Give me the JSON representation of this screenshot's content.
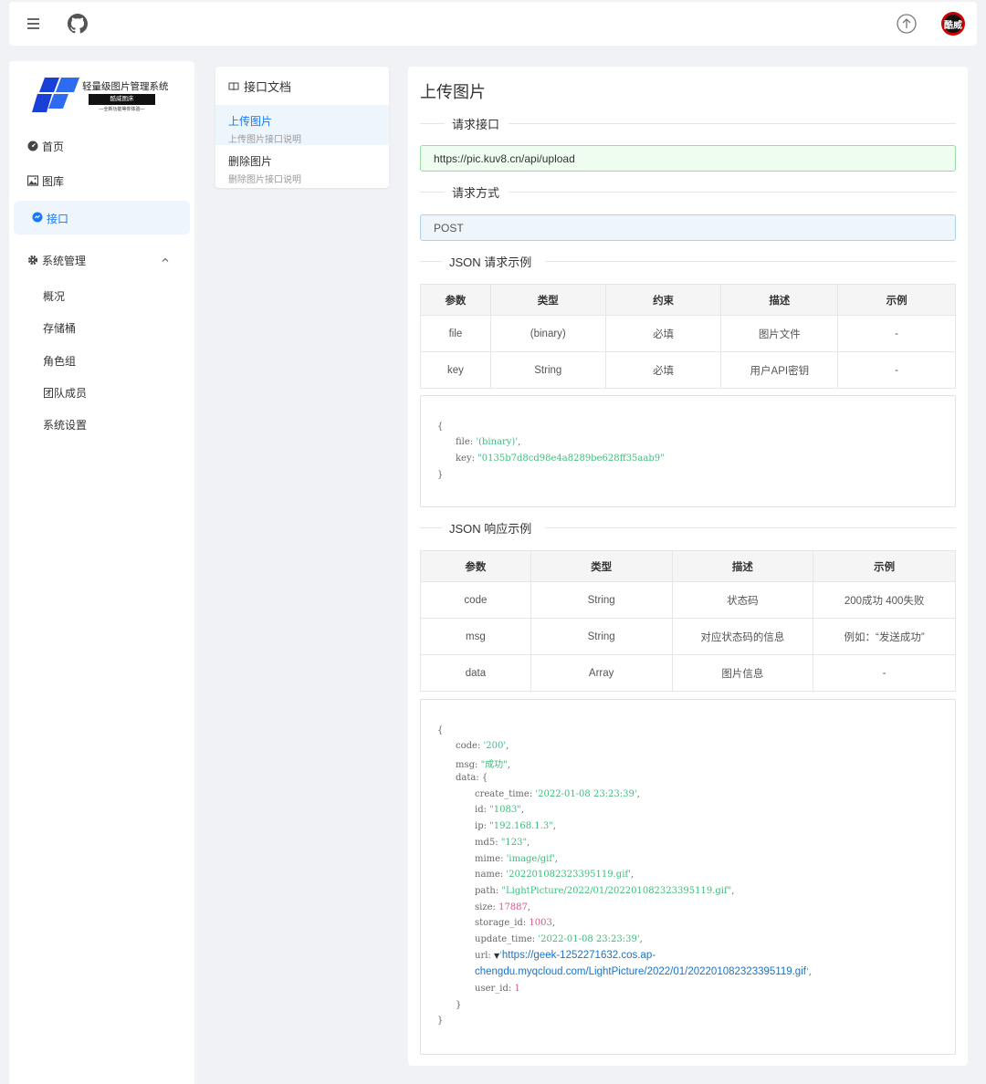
{
  "brand": {
    "name": "轻量级图片管理系统",
    "bar_text": "酷威图床",
    "tagline": "—全新功能等你体验—"
  },
  "topbar": {
    "avatar_text": "酷威"
  },
  "sidebar": {
    "items": [
      "首页",
      "图库",
      "接口"
    ],
    "group": "系统管理",
    "sub_items": [
      "概况",
      "存储桶",
      "角色组",
      "团队成员",
      "系统设置"
    ]
  },
  "docnav": {
    "title": "接口文档",
    "items": [
      {
        "title": "上传图片",
        "desc": "上传图片接口说明"
      },
      {
        "title": "删除图片",
        "desc": "删除图片接口说明"
      }
    ]
  },
  "main": {
    "title": "上传图片",
    "endpoint_label": "请求接口",
    "endpoint": "https://pic.kuv8.cn/api/upload",
    "method_label": "请求方式",
    "method": "POST",
    "req_label": "JSON 请求示例",
    "req_headers": [
      "参数",
      "类型",
      "约束",
      "描述",
      "示例"
    ],
    "req_rows": [
      [
        "file",
        "(binary)",
        "必填",
        "图片文件",
        "-"
      ],
      [
        "key",
        "String",
        "必填",
        "用户API密钥",
        "-"
      ]
    ],
    "req_code": {
      "open": "{",
      "file_key": "file:",
      "file_val": "'(binary)'",
      "key_key": "key:",
      "key_val": "\"0135b7d8cd98e4a8289be628ff35aab9\"",
      "close": "}"
    },
    "res_label": "JSON 响应示例",
    "res_headers": [
      "参数",
      "类型",
      "描述",
      "示例"
    ],
    "res_rows": [
      [
        "code",
        "String",
        "状态码",
        "200成功 400失败"
      ],
      [
        "msg",
        "String",
        "对应状态码的信息",
        "例如：“发送成功”"
      ],
      [
        "data",
        "Array",
        "图片信息",
        "-"
      ]
    ],
    "res_code": {
      "open": "{",
      "code_key": "code:",
      "code_val": "'200'",
      "msg_key": "msg:",
      "msg_val": "\"成功\"",
      "data_key": "data: {",
      "create_time_key": "create_time:",
      "create_time_val": "'2022-01-08 23:23:39'",
      "id_key": "id:",
      "id_val": "\"1083\"",
      "ip_key": "ip:",
      "ip_val": "\"192.168.1.3\"",
      "md5_key": "md5:",
      "md5_val": "\"123\"",
      "mime_key": "mime:",
      "mime_val": "'image/gif'",
      "name_key": "name:",
      "name_val": "'202201082323395119.gif'",
      "path_key": "path:",
      "path_val": "\"LightPicture/2022/01/202201082323395119.gif\"",
      "size_key": "size:",
      "size_val": "17887",
      "storage_id_key": "storage_id:",
      "storage_id_val": "1003",
      "update_time_key": "update_time:",
      "update_time_val": "'2022-01-08 23:23:39'",
      "url_key": "url:",
      "url_val_1": "https://geek-1252271632.cos.ap-",
      "url_val_2": "chengdu.myqcloud.com/LightPicture/2022/01/202201082323395119.gif",
      "user_id_key": "user_id:",
      "user_id_val": "1",
      "inner_close": "}",
      "close": "}"
    }
  }
}
